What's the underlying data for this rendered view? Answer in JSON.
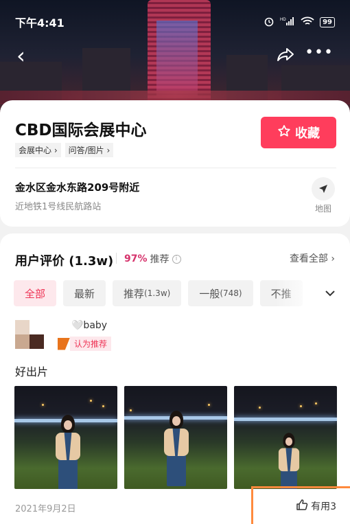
{
  "status_bar": {
    "time": "下午4:41",
    "battery": "99",
    "network": "HD"
  },
  "venue": {
    "name": "CBD国际会展中心",
    "tags": [
      "会展中心 ›",
      "问答/图片 ›"
    ],
    "favorite_label": "收藏",
    "address": "金水区金水东路209号附近",
    "metro": "近地铁1号线民航路站",
    "map_label": "地图"
  },
  "reviews": {
    "title": "用户评价 (1.3w)",
    "recommend_pct": "97%",
    "recommend_label": "推荐",
    "see_all": "查看全部",
    "filters": [
      {
        "label": "全部",
        "count": ""
      },
      {
        "label": "最新",
        "count": ""
      },
      {
        "label": "推荐",
        "count": "(1.3w)"
      },
      {
        "label": "一般",
        "count": "(748)"
      },
      {
        "label": "不推",
        "count": ""
      }
    ],
    "item": {
      "username": "🤍baby",
      "badge": "认为推荐",
      "text": "好出片",
      "date": "2021年9月2日",
      "useful": "有用3"
    }
  },
  "colors": {
    "accent": "#ff3d5c",
    "active_chip_bg": "#fde8ec",
    "active_chip_text": "#ee3355",
    "badge_flag": "#e8741c",
    "highlight": "#ff8a3d"
  }
}
